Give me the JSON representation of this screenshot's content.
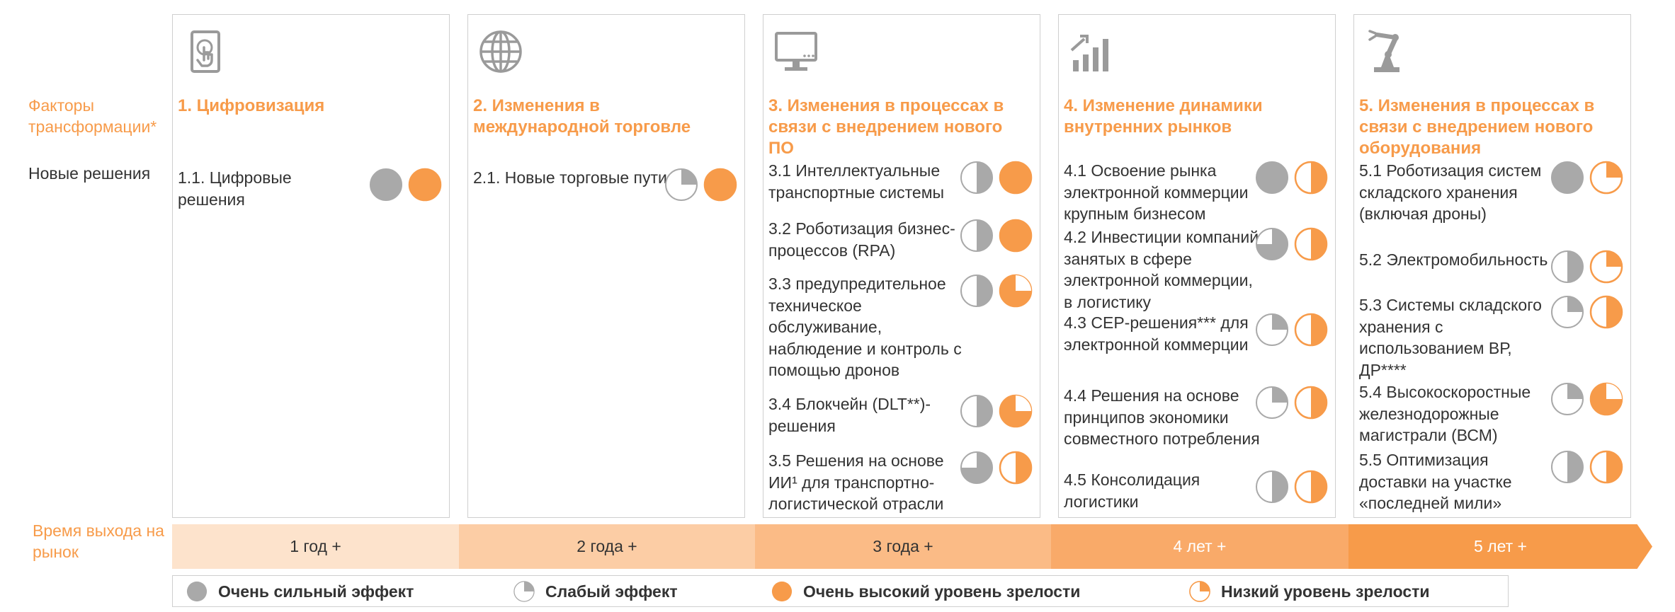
{
  "side": {
    "factors": "Факторы трансформации*",
    "solutions": "Новые решения",
    "time": "Время выхода на рынок"
  },
  "colors": {
    "orange": "#F79B4A",
    "gray": "#A9A9A9"
  },
  "columns": [
    {
      "icon": "touch-tablet-icon",
      "title": "1. Цифровизация",
      "items": [
        {
          "text": "1.1. Цифровые решения",
          "effect": "strong",
          "maturity": "very-high"
        }
      ]
    },
    {
      "icon": "globe-icon",
      "title": "2. Изменения в международной торговле",
      "items": [
        {
          "text": "2.1. Новые торговые пути",
          "effect": "weak",
          "maturity": "very-high"
        }
      ]
    },
    {
      "icon": "monitor-icon",
      "title": "3. Изменения в процессах в связи с внедрением нового ПО",
      "items": [
        {
          "text": "3.1 Интеллектуальные транспортные системы",
          "effect": "half",
          "maturity": "very-high"
        },
        {
          "text": "3.2 Роботизация бизнес-процессов (RPA)",
          "effect": "half",
          "maturity": "very-high"
        },
        {
          "text": "3.3 предупредительное техническое обслуживание, наблюдение и контроль с помощью дронов",
          "effect": "half",
          "maturity": "high-quarter"
        },
        {
          "text": "3.4 Блокчейн (DLT**)-решения",
          "effect": "half",
          "maturity": "high-quarter"
        },
        {
          "text": "3.5 Решения на основе ИИ¹ для транспортно-логистической отрасли",
          "effect": "three-quarter",
          "maturity": "half"
        }
      ]
    },
    {
      "icon": "bar-chart-icon",
      "title": "4. Изменение динамики внутренних рынков",
      "items": [
        {
          "text": "4.1 Освоение рынка электронной коммерции крупным бизнесом",
          "effect": "strong",
          "maturity": "half"
        },
        {
          "text": "4.2 Инвестиции компаний, занятых в сфере электронной коммерции, в логистику",
          "effect": "three-quarter",
          "maturity": "half"
        },
        {
          "text": "4.3 CEP-решения*** для электронной коммерции",
          "effect": "weak",
          "maturity": "half"
        },
        {
          "text": "4.4 Решения на основе принципов экономики совместного потребления",
          "effect": "weak",
          "maturity": "half"
        },
        {
          "text": "4.5 Консолидация логистики",
          "effect": "half",
          "maturity": "half"
        }
      ]
    },
    {
      "icon": "robot-arm-icon",
      "title": "5. Изменения в процессах в связи с внедрением нового оборудования",
      "items": [
        {
          "text": "5.1 Роботизация систем складского хранения (включая дроны)",
          "effect": "strong",
          "maturity": "low"
        },
        {
          "text": "5.2 Электромобильность",
          "effect": "half",
          "maturity": "low"
        },
        {
          "text": "5.3 Системы складского хранения с использованием ВР, ДР****",
          "effect": "weak",
          "maturity": "half"
        },
        {
          "text": "5.4 Высокоскоростные железнодорожные магистрали (ВСМ)",
          "effect": "weak",
          "maturity": "high-quarter"
        },
        {
          "text": "5.5 Оптимизация доставки на участке «последней мили»",
          "effect": "half",
          "maturity": "half"
        }
      ]
    }
  ],
  "timeline": [
    {
      "label": "1 год +",
      "color": "#FDE3CC",
      "text_color": "#333333"
    },
    {
      "label": "2 года +",
      "color": "#FCCDA5",
      "text_color": "#333333"
    },
    {
      "label": "3 года +",
      "color": "#FBBB86",
      "text_color": "#333333"
    },
    {
      "label": "4 лет +",
      "color": "#F9AA69",
      "text_color": "#ffffff"
    },
    {
      "label": "5 лет +",
      "color": "#F79B4A",
      "text_color": "#ffffff"
    }
  ],
  "legend": [
    {
      "kind": "strong-effect",
      "label": "Очень сильный эффект"
    },
    {
      "kind": "weak-effect",
      "label": "Слабый эффект"
    },
    {
      "kind": "very-high-maturity",
      "label": "Очень высокий уровень зрелости"
    },
    {
      "kind": "low-maturity",
      "label": "Низкий уровень зрелости"
    }
  ]
}
